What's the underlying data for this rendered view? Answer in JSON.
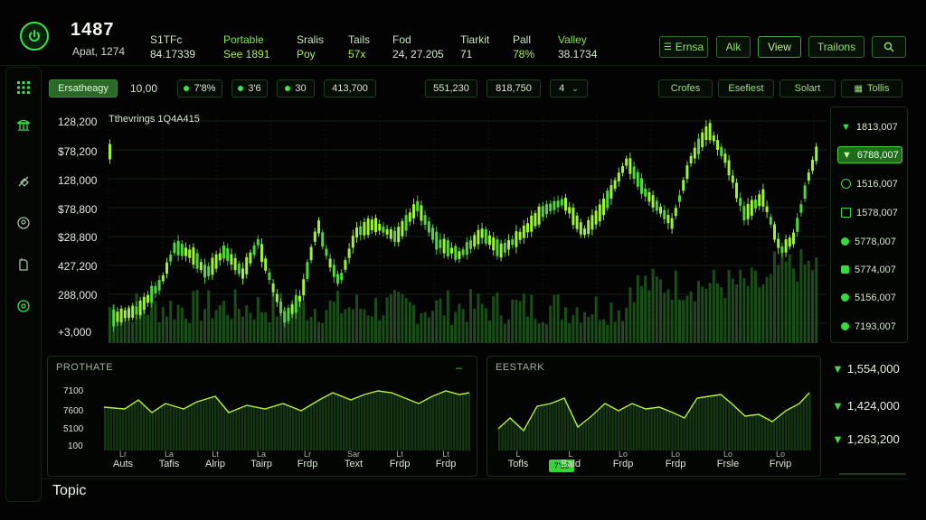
{
  "header": {
    "title": "1487",
    "subtitle": "Apat, 1274",
    "stats": [
      {
        "label": "S1TFc",
        "value": "84.17339",
        "green": false
      },
      {
        "label": "Portable",
        "value": "See 1891",
        "green": true
      },
      {
        "label": "Sralis",
        "value": "Poy",
        "green": true
      },
      {
        "label": "Tails",
        "value": "57x",
        "green": true
      },
      {
        "label": "Fod",
        "value": "24, 27.205",
        "green": false
      },
      {
        "label": "Tiarkit",
        "value": "71",
        "green": false
      },
      {
        "label": "Pall",
        "value": "78%",
        "green": true
      },
      {
        "label": "Valley",
        "value": "38.1734",
        "green": true
      }
    ],
    "buttons": [
      "Ernsa",
      "Alk",
      "View",
      "Trailons"
    ]
  },
  "toolbar": {
    "chips": [
      "Ersatheagy",
      "10,00",
      "7'8%",
      "3'6",
      "30",
      "413,700"
    ],
    "chips2": [
      "551,230",
      "818,750",
      "4"
    ],
    "actions": [
      "Crofes",
      "Esefiest",
      "Solart",
      "Tollis"
    ]
  },
  "main_chart": {
    "annotation": "Tthevrings 1Q4A415",
    "y_labels": [
      "128,200",
      "$78,200",
      "128,000",
      "$78,800",
      "$28,800",
      "427,200",
      "288,000",
      "+3,000"
    ]
  },
  "right_list": {
    "items": [
      "1813,007",
      "6788,007",
      "1516,007",
      "1578,007",
      "5778,007",
      "5774,007",
      "5156,007",
      "7193,007"
    ],
    "selected_index": 1,
    "values": [
      "1,554,000",
      "1,424,000",
      "1,263,200"
    ]
  },
  "mini_charts": [
    {
      "title": "PROTHATE",
      "y_labels": [
        "7100",
        "7600",
        "5100",
        "100"
      ],
      "x_labels": [
        {
          "t": "Lr",
          "l": "Auts"
        },
        {
          "t": "La",
          "l": "Tafis"
        },
        {
          "t": "Lt",
          "l": "Alrip"
        },
        {
          "t": "La",
          "l": "Tairp"
        },
        {
          "t": "Lr",
          "l": "Frdp"
        },
        {
          "t": "Sar",
          "l": "Text"
        },
        {
          "t": "Lt",
          "l": "Frdp"
        },
        {
          "t": "Lt",
          "l": "Frdp"
        }
      ]
    },
    {
      "title": "EESTARK",
      "badge": "7'58",
      "x_labels": [
        {
          "t": "L",
          "l": "Tofls"
        },
        {
          "t": "L",
          "l": "Bald"
        },
        {
          "t": "Lo",
          "l": "Frdp"
        },
        {
          "t": "Lo",
          "l": "Frdp"
        },
        {
          "t": "Lo",
          "l": "Frsle"
        },
        {
          "t": "Lo",
          "l": "Frvip"
        }
      ]
    }
  ],
  "footer": {
    "topic": "Topic"
  },
  "colors": {
    "accent": "#3be04a",
    "bright": "#b8f23a",
    "dark_bar": "#1f5a1c",
    "panel": "#030503"
  }
}
